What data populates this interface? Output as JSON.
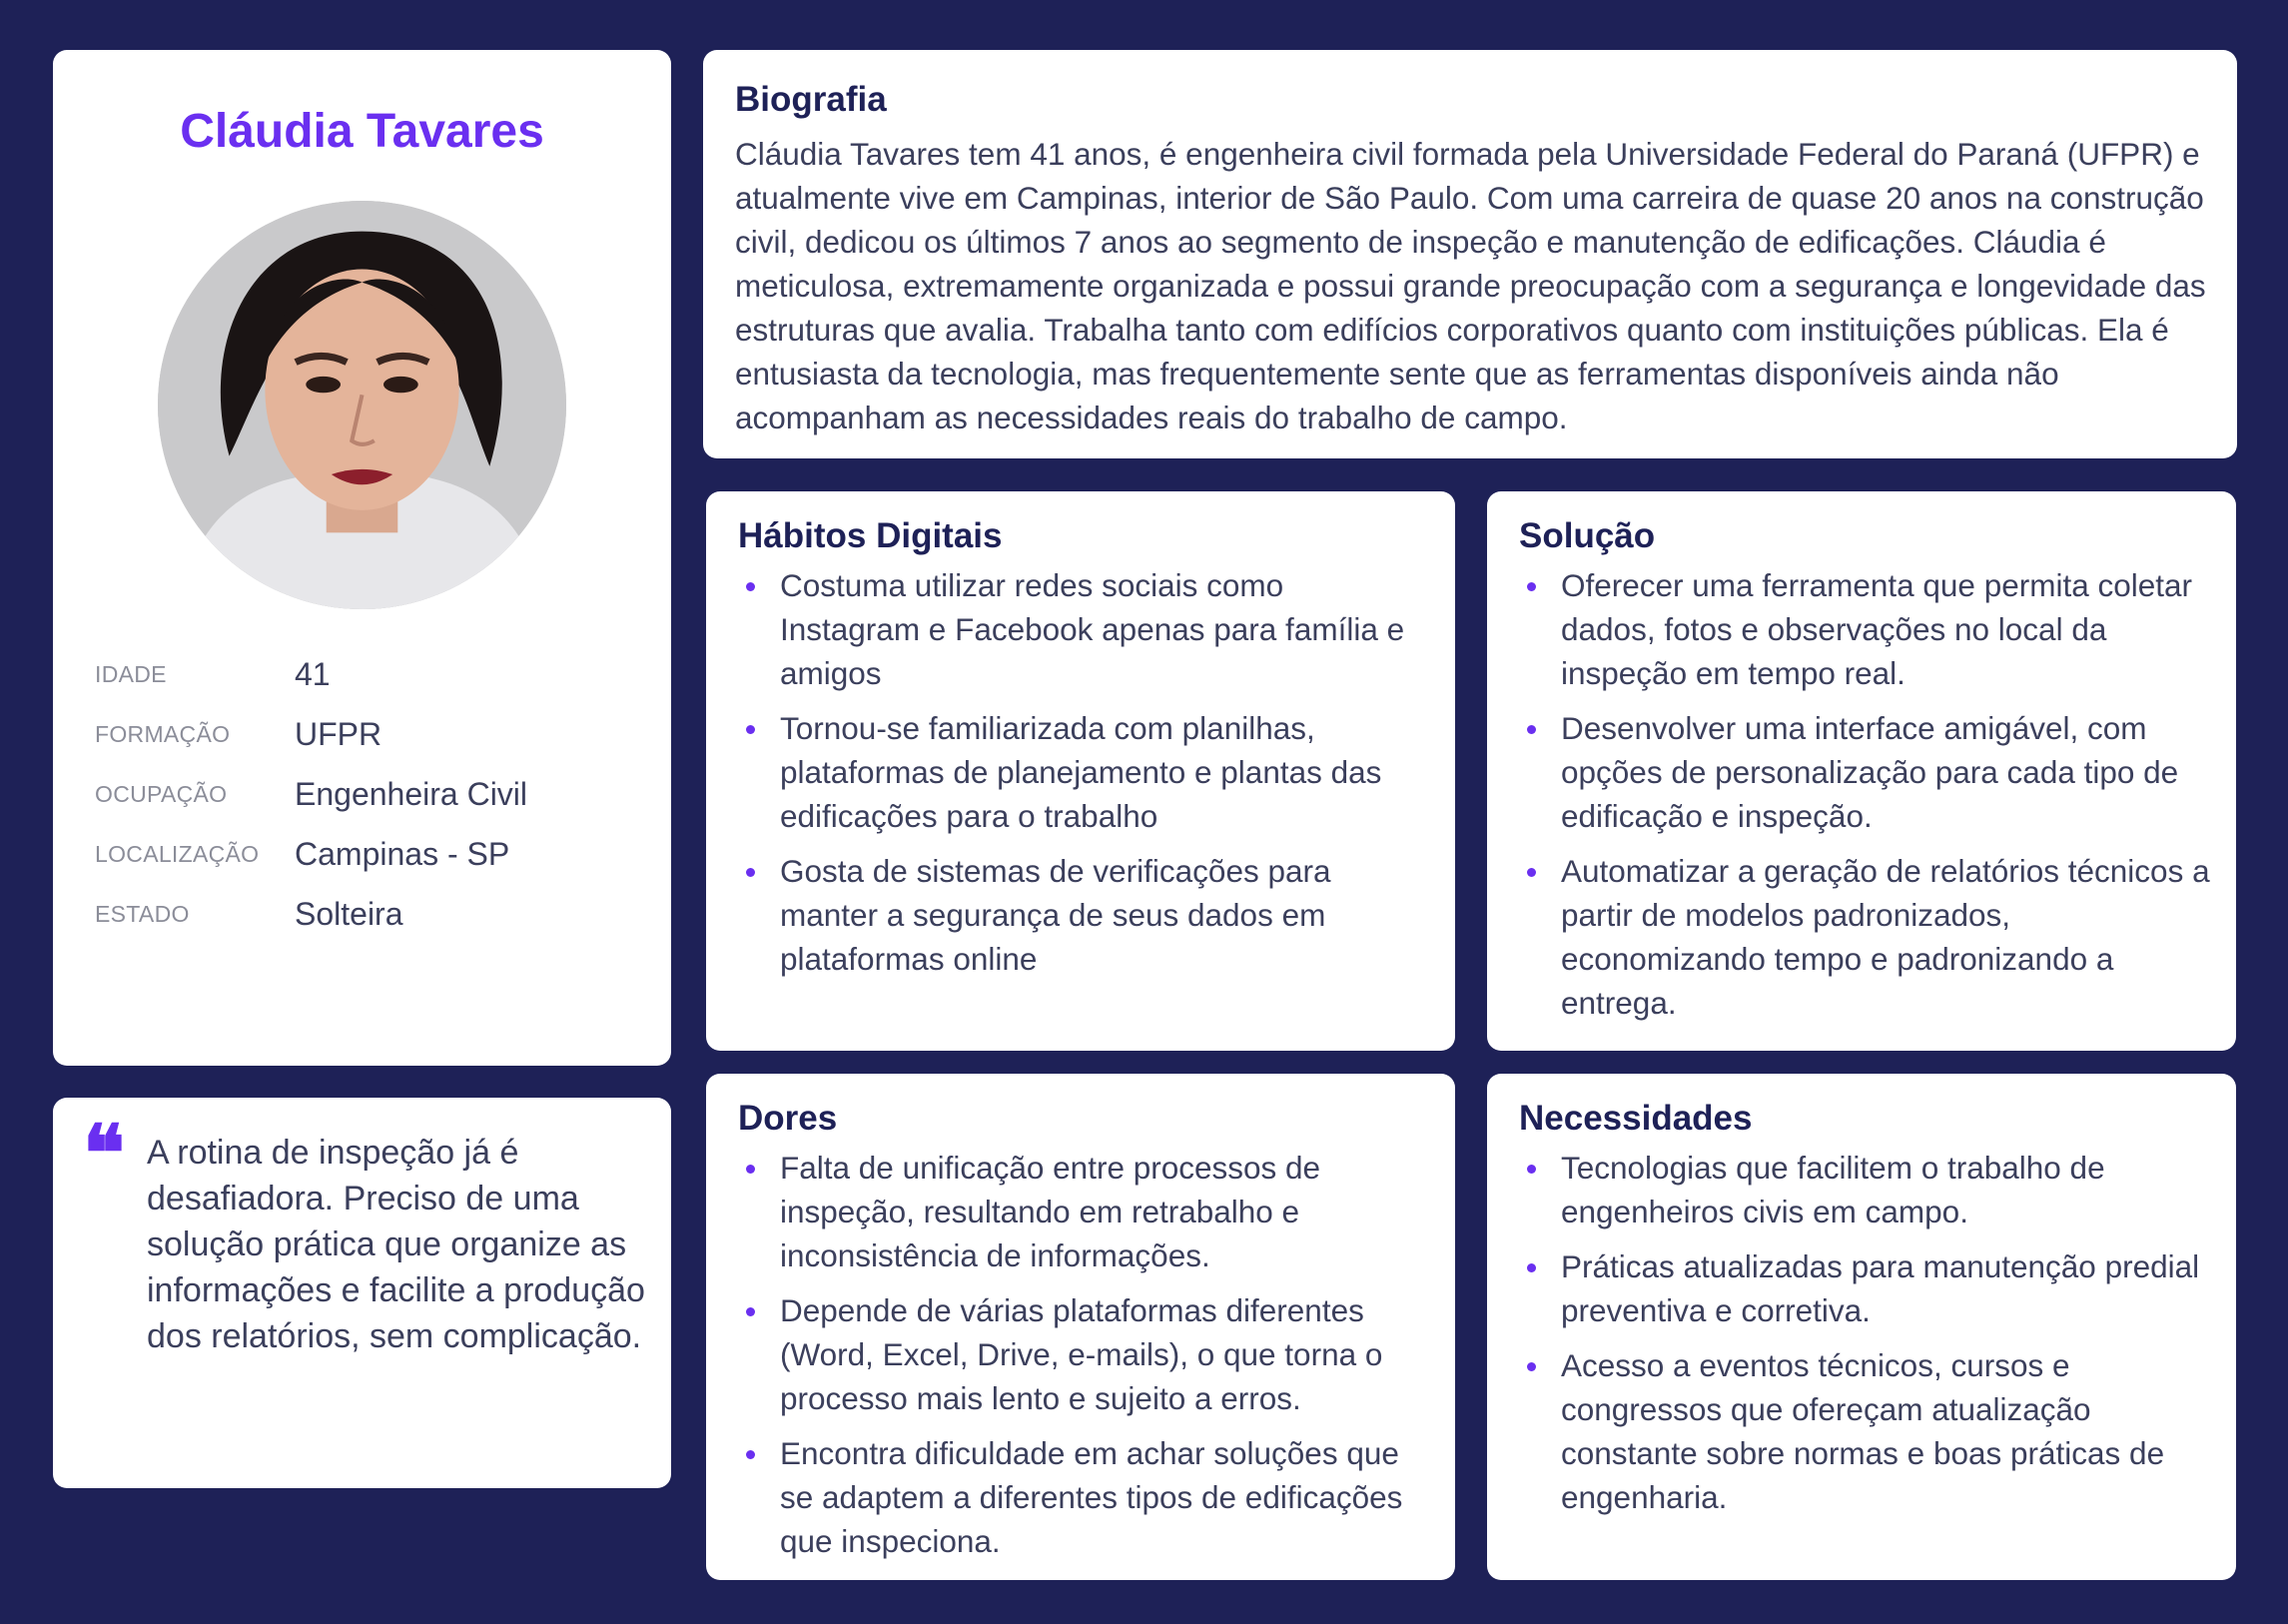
{
  "profile": {
    "name": "Cláudia Tavares",
    "fields": [
      {
        "label": "IDADE",
        "value": "41"
      },
      {
        "label": "FORMAÇÃO",
        "value": "UFPR"
      },
      {
        "label": "OCUPAÇÃO",
        "value": "Engenheira Civil"
      },
      {
        "label": "LOCALIZAÇÃO",
        "value": "Campinas - SP"
      },
      {
        "label": "ESTADO",
        "value": "Solteira"
      }
    ]
  },
  "quote": {
    "mark": "❝",
    "text": "A rotina de inspeção já é desafiadora. Preciso de uma solução prática que organize as informações e facilite a produção dos relatórios, sem complicação."
  },
  "bio": {
    "title": "Biografia",
    "text": "Cláudia Tavares tem 41 anos, é engenheira civil formada pela Universidade Federal do Paraná (UFPR) e atualmente vive em Campinas, interior de São Paulo. Com uma carreira de quase 20 anos na construção civil, dedicou os últimos 7 anos ao segmento de inspeção e manutenção de edificações. Cláudia é meticulosa, extremamente organizada e possui grande preocupação com a segurança e longevidade das estruturas que avalia. Trabalha tanto com edifícios corporativos quanto com instituições públicas. Ela é entusiasta da tecnologia, mas frequentemente sente que as ferramentas disponíveis ainda não acompanham as necessidades reais do trabalho de campo."
  },
  "habitos": {
    "title": "Hábitos Digitais",
    "items": [
      "Costuma utilizar redes sociais como Instagram e Facebook apenas para família e amigos",
      "Tornou-se familiarizada com planilhas, plataformas de planejamento e plantas das edificações para o trabalho",
      "Gosta de sistemas de verificações para manter a segurança de seus dados em plataformas online"
    ]
  },
  "solucao": {
    "title": "Solução",
    "items": [
      "Oferecer uma ferramenta que permita coletar dados, fotos e observações no local da inspeção em tempo real.",
      "Desenvolver uma interface amigável, com opções de personalização para cada tipo de edificação e inspeção.",
      "Automatizar a geração de relatórios técnicos a partir de modelos padronizados, economizando tempo e padronizando a entrega."
    ]
  },
  "dores": {
    "title": "Dores",
    "items": [
      "Falta de unificação entre processos de inspeção, resultando em retrabalho e inconsistência de informações.",
      "Depende de várias plataformas diferentes (Word, Excel, Drive, e-mails), o que torna o processo mais lento e sujeito a erros.",
      "Encontra dificuldade em achar soluções que se adaptem a diferentes tipos de edificações que inspeciona."
    ]
  },
  "necessidades": {
    "title": "Necessidades",
    "items": [
      "Tecnologias que facilitem o trabalho de engenheiros civis em campo.",
      "Práticas atualizadas para manutenção predial preventiva e corretiva.",
      "Acesso a eventos técnicos, cursos e congressos que ofereçam atualização constante sobre normas e boas práticas de engenharia."
    ]
  },
  "colors": {
    "background": "#1e2157",
    "accent": "#6a2ff0",
    "card": "#ffffff",
    "heading": "#1e2157",
    "text": "#3b3f5c",
    "muted": "#8b8d99"
  }
}
